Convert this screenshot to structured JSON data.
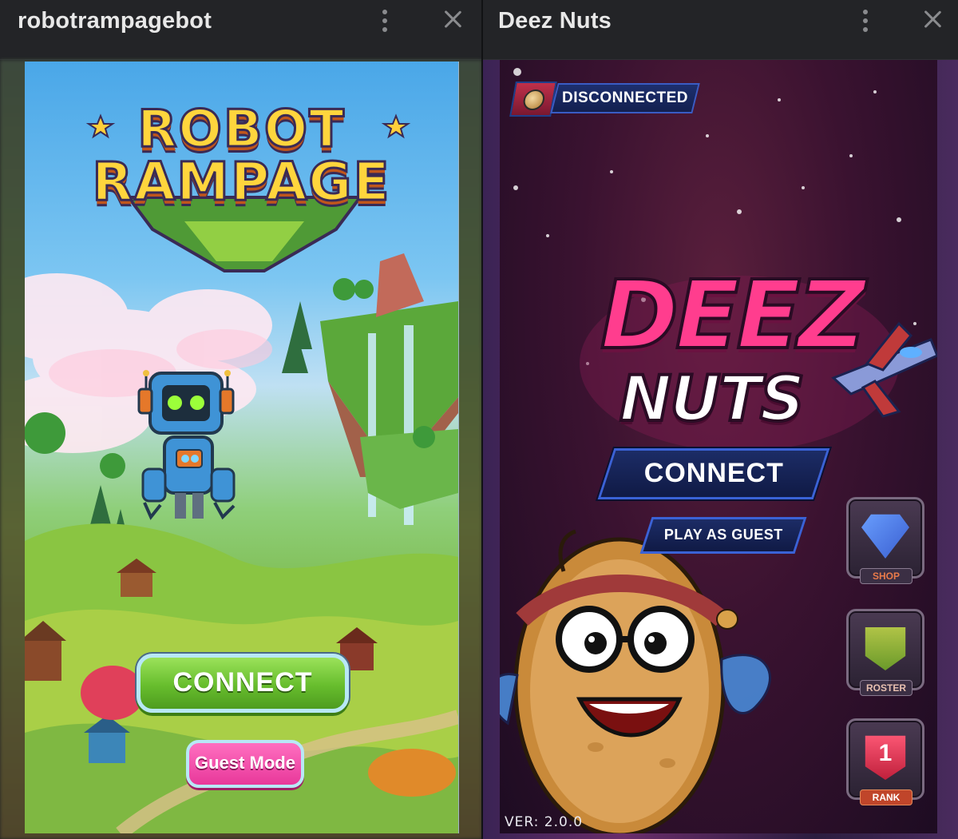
{
  "left_window": {
    "title": "robotrampagebot",
    "game": {
      "logo_line1": "ROBOT",
      "logo_line2": "RAMPAGE",
      "connect_label": "CONNECT",
      "guest_label": "Guest Mode"
    }
  },
  "right_window": {
    "title": "Deez Nuts",
    "game": {
      "status_label": "DISCONNECTED",
      "logo_line1": "DEEZ",
      "logo_line2": "NUTS",
      "connect_label": "CONNECT",
      "guest_label": "PLAY AS GUEST",
      "side_buttons": [
        {
          "label": "SHOP",
          "icon": "diamond-icon"
        },
        {
          "label": "ROSTER",
          "icon": "shield-icon"
        },
        {
          "label": "RANK",
          "icon": "rank-badge-icon",
          "value": "1"
        }
      ],
      "version": "VER: 2.0.0"
    }
  },
  "icons": {
    "menu": "kebab-menu-icon",
    "close": "close-icon"
  },
  "colors": {
    "titlebar_bg": "#232427",
    "rr_connect_green": "#67bd2d",
    "rr_guest_pink": "#e8389a",
    "dn_logo_pink": "#ff3d8e",
    "dn_button_navy": "#1c2c66"
  }
}
